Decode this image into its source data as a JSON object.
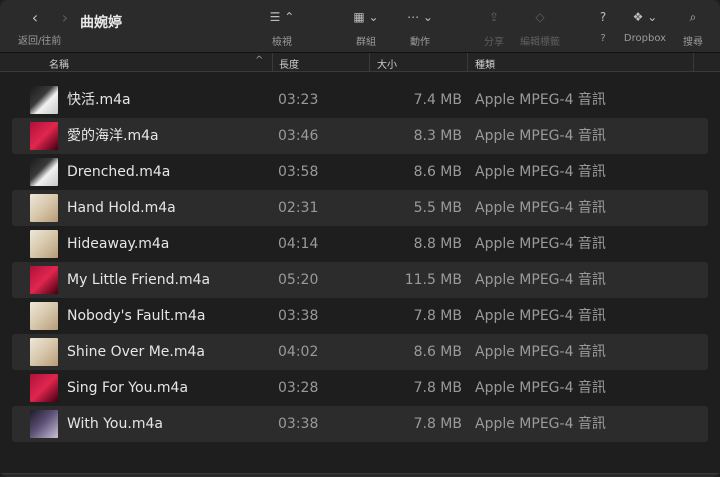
{
  "window": {
    "title": "曲婉婷",
    "nav_label": "返回/往前",
    "back_icon": "‹",
    "forward_icon": "›"
  },
  "toolbar": {
    "view": {
      "label": "檢視",
      "icon": "☰ ⌃"
    },
    "group": {
      "label": "群組",
      "icon": "▦ ⌄"
    },
    "action": {
      "label": "動作",
      "icon": "⋯ ⌄"
    },
    "share": {
      "label": "分享",
      "icon": "⇪"
    },
    "tags": {
      "label": "編輯標籤",
      "icon": "◇"
    },
    "help": {
      "label": "?",
      "icon": "?"
    },
    "dropbox": {
      "label": "Dropbox",
      "icon": "❖ ⌄"
    },
    "search": {
      "label": "搜尋",
      "icon": "⌕"
    }
  },
  "columns": {
    "name": "名稱",
    "duration": "長度",
    "size": "大小",
    "kind": "種類"
  },
  "files": [
    {
      "name": "快活.m4a",
      "duration": "03:23",
      "size": "7.4 MB",
      "kind": "Apple MPEG-4 音訊",
      "art": "a"
    },
    {
      "name": "愛的海洋.m4a",
      "duration": "03:46",
      "size": "8.3 MB",
      "kind": "Apple MPEG-4 音訊",
      "art": "b"
    },
    {
      "name": "Drenched.m4a",
      "duration": "03:58",
      "size": "8.6 MB",
      "kind": "Apple MPEG-4 音訊",
      "art": "a"
    },
    {
      "name": "Hand Hold.m4a",
      "duration": "02:31",
      "size": "5.5 MB",
      "kind": "Apple MPEG-4 音訊",
      "art": "c"
    },
    {
      "name": "Hideaway.m4a",
      "duration": "04:14",
      "size": "8.8 MB",
      "kind": "Apple MPEG-4 音訊",
      "art": "c"
    },
    {
      "name": "My Little Friend.m4a",
      "duration": "05:20",
      "size": "11.5 MB",
      "kind": "Apple MPEG-4 音訊",
      "art": "b"
    },
    {
      "name": "Nobody's Fault.m4a",
      "duration": "03:38",
      "size": "7.8 MB",
      "kind": "Apple MPEG-4 音訊",
      "art": "c"
    },
    {
      "name": "Shine Over Me.m4a",
      "duration": "04:02",
      "size": "8.6 MB",
      "kind": "Apple MPEG-4 音訊",
      "art": "c"
    },
    {
      "name": "Sing For You.m4a",
      "duration": "03:28",
      "size": "7.8 MB",
      "kind": "Apple MPEG-4 音訊",
      "art": "b"
    },
    {
      "name": "With You.m4a",
      "duration": "03:38",
      "size": "7.8 MB",
      "kind": "Apple MPEG-4 音訊",
      "art": "d"
    }
  ]
}
